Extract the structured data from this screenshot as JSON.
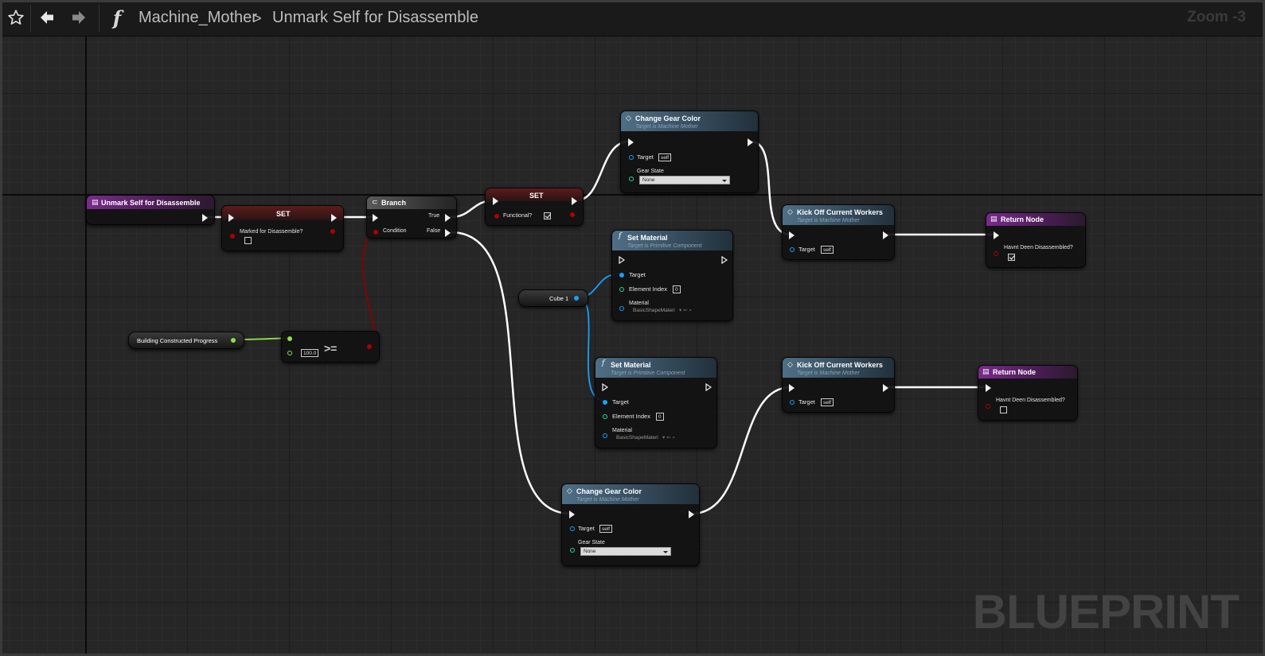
{
  "toolbar": {
    "breadcrumb_root": "Machine_Mother",
    "breadcrumb_sep": ">",
    "breadcrumb_leaf": "Unmark Self for Disassemble",
    "zoom_label": "Zoom -3",
    "function_symbol": "f"
  },
  "icons": {
    "favorite": "star-icon",
    "back": "back-arrow-icon",
    "forward": "forward-arrow-icon",
    "function": "function-icon"
  },
  "colors": {
    "exec_wire": "#ffffff",
    "bool_wire": "#8c0000",
    "float_wire": "#8fe04a",
    "object_wire": "#18a0ff",
    "function_entry": "#7a2a8c",
    "function_call": "#4f6f86"
  },
  "watermark": "BLUEPRINT",
  "nodes": {
    "entry": {
      "title": "Unmark Self for Disassemble"
    },
    "set_marked": {
      "title": "SET",
      "pin_label": "Marked for Disassemble?",
      "value": false
    },
    "branch": {
      "title": "Branch",
      "condition": "Condition",
      "true_label": "True",
      "false_label": "False"
    },
    "set_functional": {
      "title": "SET",
      "pin_label": "Functional?",
      "value": true
    },
    "change_gear_1": {
      "title": "Change Gear Color",
      "subtitle": "Target is Machine Mother",
      "target_label": "Target",
      "target_value": "self",
      "gear_label": "Gear State",
      "gear_value": "None"
    },
    "kick_off_1": {
      "title": "Kick Off Current Workers",
      "subtitle": "Target is Machine Mother",
      "target_label": "Target",
      "target_value": "self"
    },
    "return_1": {
      "title": "Return Node",
      "pin_label": "Havnt Deen Disassembled?",
      "value": true
    },
    "set_material_1": {
      "title": "Set Material",
      "subtitle": "Target is Primitive Component",
      "target_label": "Target",
      "index_label": "Element Index",
      "index_value": "0",
      "material_label": "Material",
      "material_value": "BasicShapeMateri"
    },
    "cube_var": {
      "label": "Cube 1"
    },
    "set_material_2": {
      "title": "Set Material",
      "subtitle": "Target is Primitive Component",
      "target_label": "Target",
      "index_label": "Element Index",
      "index_value": "0",
      "material_label": "Material",
      "material_value": "BasicShapeMateri"
    },
    "kick_off_2": {
      "title": "Kick Off Current Workers",
      "subtitle": "Target is Machine Mother",
      "target_label": "Target",
      "target_value": "self"
    },
    "return_2": {
      "title": "Return Node",
      "pin_label": "Havnt Deen Disassembled?",
      "value": false
    },
    "change_gear_2": {
      "title": "Change Gear Color",
      "subtitle": "Target is Machine Mother",
      "target_label": "Target",
      "target_value": "self",
      "gear_label": "Gear State",
      "gear_value": "None"
    },
    "building_var": {
      "label": "Building Constructed Progress"
    },
    "compare": {
      "op": ">=",
      "value": "100.0"
    }
  }
}
